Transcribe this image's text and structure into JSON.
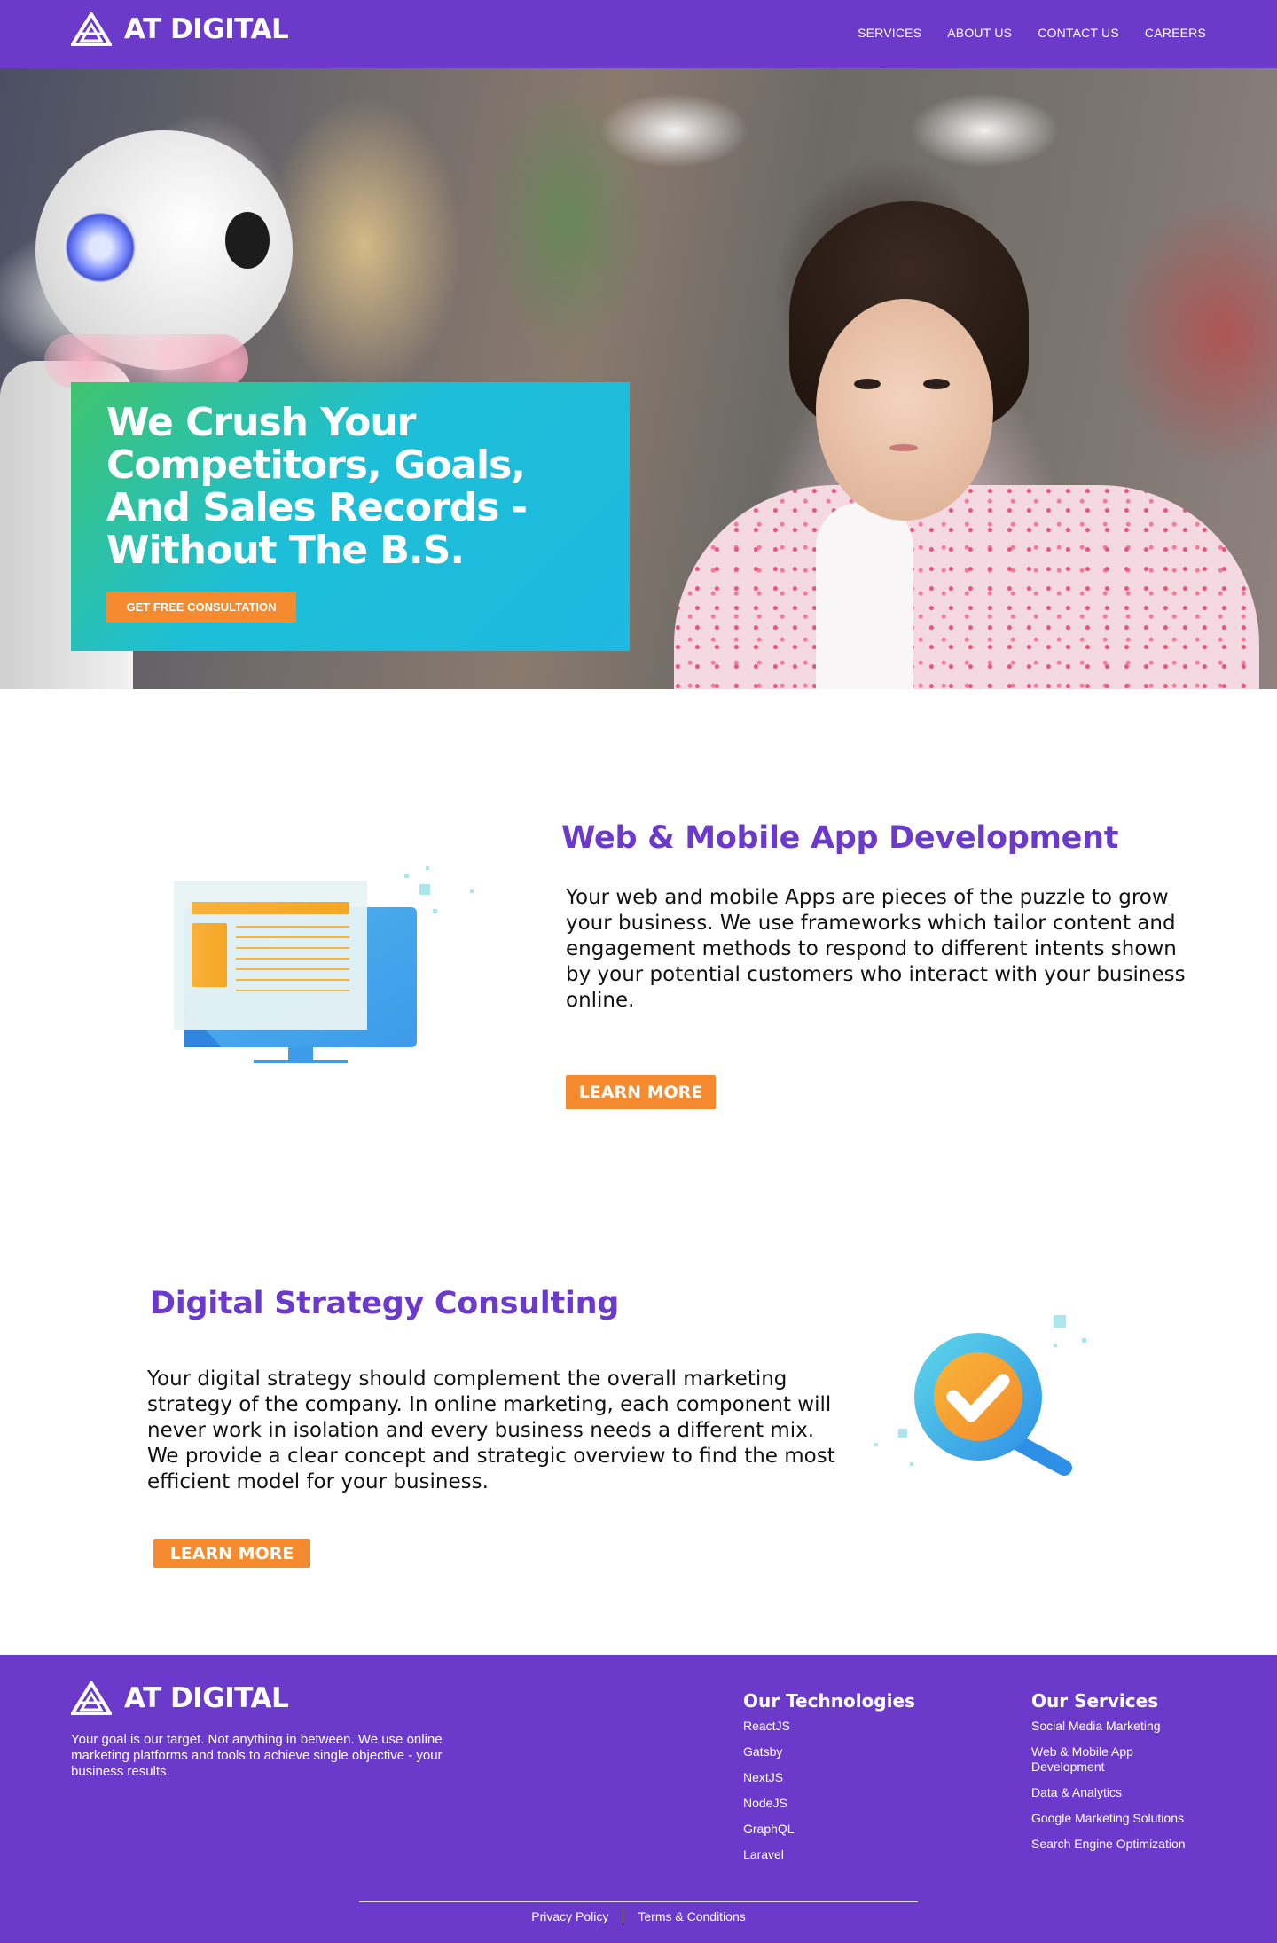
{
  "brand": {
    "name": "AT DIGITAL",
    "color": "#6b3acb"
  },
  "nav": {
    "links": [
      "SERVICES",
      "ABOUT US",
      "CONTACT US",
      "CAREERS"
    ]
  },
  "hero": {
    "title": "We Crush Your Competitors, Goals, And Sales Records - Without The B.S.",
    "cta": "GET FREE CONSULTATION"
  },
  "services": [
    {
      "title": "Web & Mobile App Development",
      "body": "Your web and mobile Apps are pieces of the puzzle to grow your business. We use frameworks which tailor content and engagement methods to respond to different intents shown by your potential customers who interact with your business online.",
      "button": "LEARN MORE",
      "icon": "monitor-icon"
    },
    {
      "title": "Digital Strategy Consulting",
      "body": "Your digital strategy should complement the overall marketing strategy of the company. In online marketing, each component will never work in isolation and every business needs a different mix. We provide a clear concept and strategic overview to find the most efficient model for your business.",
      "button": "LEARN MORE",
      "icon": "magnifier-check-icon"
    }
  ],
  "footer": {
    "tagline": "Your goal is our target. Not anything in between. We use online marketing platforms and tools to achieve single objective - your business results.",
    "technologies": {
      "heading": "Our Technologies",
      "items": [
        "ReactJS",
        "Gatsby",
        "NextJS",
        "NodeJS",
        "GraphQL",
        "Laravel"
      ]
    },
    "services": {
      "heading": "Our Services",
      "items": [
        "Social Media Marketing",
        "Web & Mobile App Development",
        "Data & Analytics",
        "Google Marketing Solutions",
        "Search Engine Optimization"
      ]
    },
    "legal": [
      "Privacy Policy",
      "Terms & Conditions"
    ]
  },
  "colors": {
    "accent": "#f58a2e",
    "purple": "#6b3acb",
    "teal": "#1dbfd8",
    "green": "#3fc46d"
  }
}
